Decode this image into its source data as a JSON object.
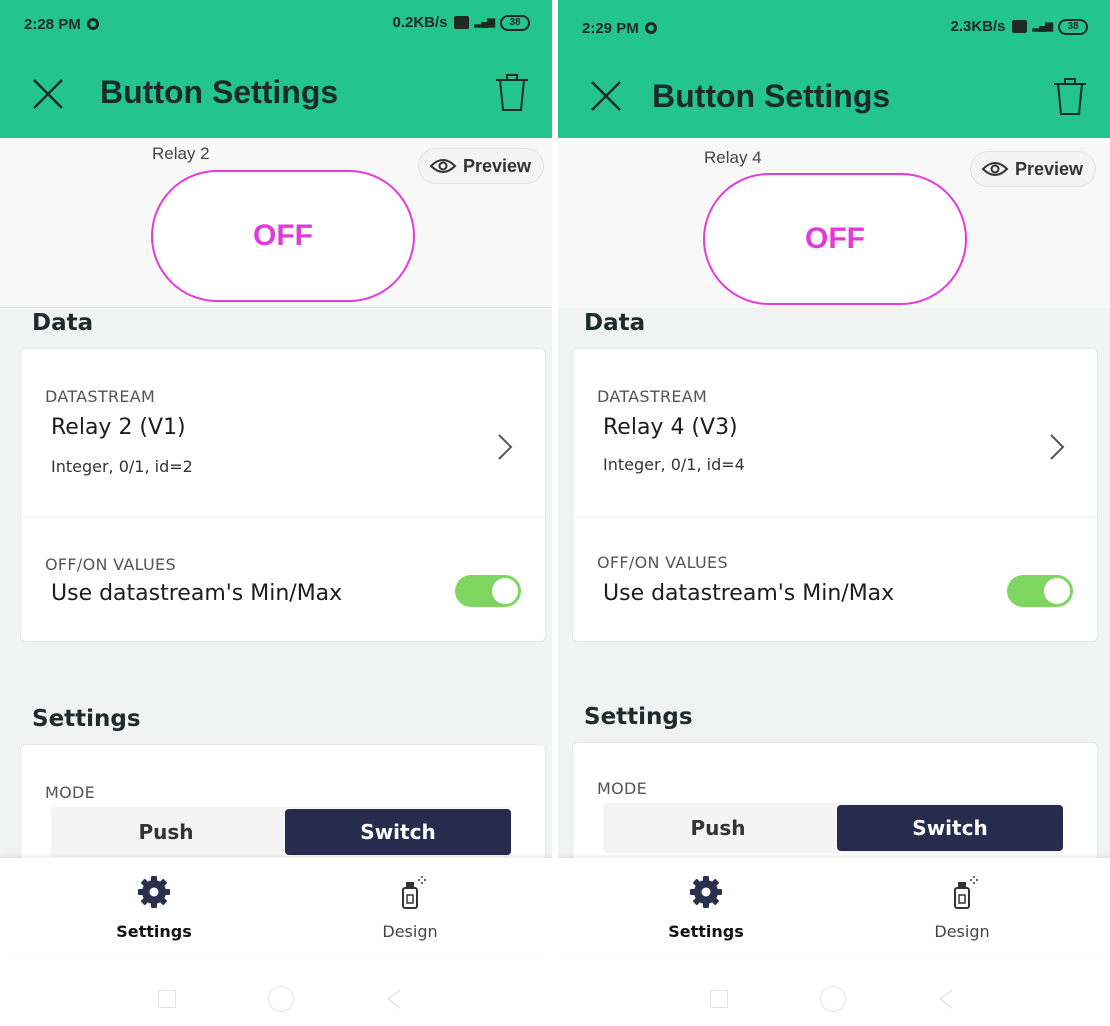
{
  "screens": [
    {
      "status": {
        "time": "2:28 PM",
        "speed": "0.2KB/s",
        "battery": "38"
      },
      "header": {
        "title": "Button Settings"
      },
      "preview": {
        "widget_label": "Relay 2",
        "preview_label": "Preview",
        "button_state": "OFF"
      },
      "data_section": {
        "title": "Data",
        "datastream_label": "DATASTREAM",
        "datastream_name": "Relay 2 (V1)",
        "datastream_info": "Integer, 0/1, id=2",
        "offon_label": "OFF/ON VALUES",
        "offon_text": "Use datastream's Min/Max",
        "offon_toggle": true
      },
      "settings_section": {
        "title": "Settings",
        "mode_label": "MODE",
        "mode_options": [
          "Push",
          "Switch"
        ],
        "mode_selected": "Switch"
      },
      "nav": {
        "settings_label": "Settings",
        "design_label": "Design",
        "active": "Settings"
      }
    },
    {
      "status": {
        "time": "2:29 PM",
        "speed": "2.3KB/s",
        "battery": "38"
      },
      "header": {
        "title": "Button Settings"
      },
      "preview": {
        "widget_label": "Relay 4",
        "preview_label": "Preview",
        "button_state": "OFF"
      },
      "data_section": {
        "title": "Data",
        "datastream_label": "DATASTREAM",
        "datastream_name": "Relay 4 (V3)",
        "datastream_info": "Integer, 0/1, id=4",
        "offon_label": "OFF/ON VALUES",
        "offon_text": "Use datastream's Min/Max",
        "offon_toggle": true
      },
      "settings_section": {
        "title": "Settings",
        "mode_label": "MODE",
        "mode_options": [
          "Push",
          "Switch"
        ],
        "mode_selected": "Switch"
      },
      "nav": {
        "settings_label": "Settings",
        "design_label": "Design",
        "active": "Settings"
      }
    }
  ],
  "colors": {
    "appbar": "#23c48e",
    "button_border": "#e63adb",
    "button_text": "#e23ad9",
    "toggle_on": "#7ed660",
    "segment_selected": "#272b4e"
  }
}
